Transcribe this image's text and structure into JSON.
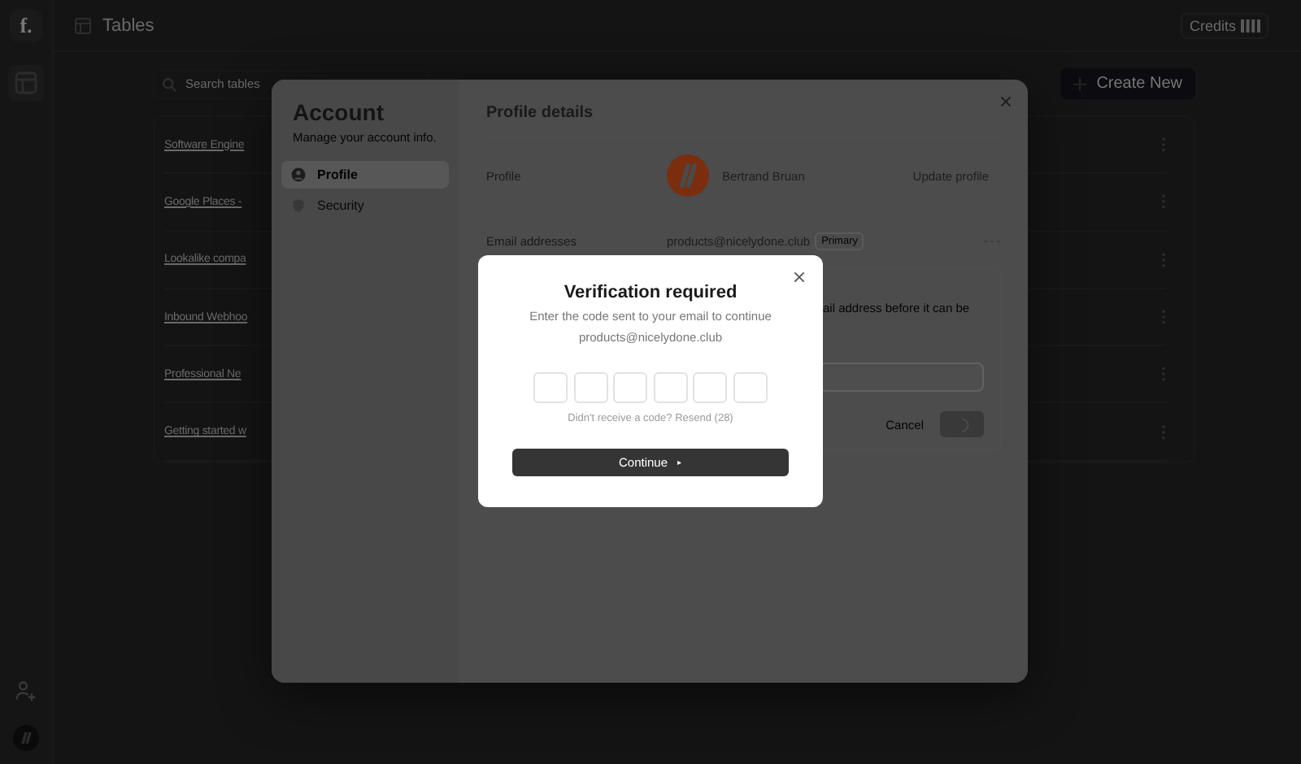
{
  "app": {
    "logo": "f.",
    "breadcrumb": "Tables",
    "credits": "Credits",
    "search_placeholder": "Search tables",
    "create_button": "Create New",
    "tables": [
      {
        "name": "Software Engine"
      },
      {
        "name": "Google Places -"
      },
      {
        "name": "Lookalike compa"
      },
      {
        "name": "Inbound Webhoo"
      },
      {
        "name": "Professional Ne"
      },
      {
        "name": "Getting started w"
      }
    ]
  },
  "account_modal": {
    "title": "Account",
    "subtitle": "Manage your account info.",
    "nav": [
      {
        "label": "Profile",
        "selected": true
      },
      {
        "label": "Security",
        "selected": false
      }
    ],
    "heading": "Profile details",
    "profile": {
      "label": "Profile",
      "name": "Bertrand Bruan",
      "action": "Update profile"
    },
    "email": {
      "label": "Email addresses",
      "address": "products@nicelydone.club",
      "badge": "Primary",
      "card_text": "ail address before it can be",
      "cancel": "Cancel"
    }
  },
  "verification": {
    "title": "Verification required",
    "message": "Enter the code sent to your email to continue",
    "email": "products@nicelydone.club",
    "code_boxes": [
      {
        "filled": false
      },
      {
        "filled": false
      },
      {
        "filled": false
      },
      {
        "filled": false
      },
      {
        "filled": false
      },
      {
        "filled": false
      }
    ],
    "resend": "Didn't receive a code? Resend (28)",
    "button": "Continue",
    "button_icon": "▸"
  }
}
